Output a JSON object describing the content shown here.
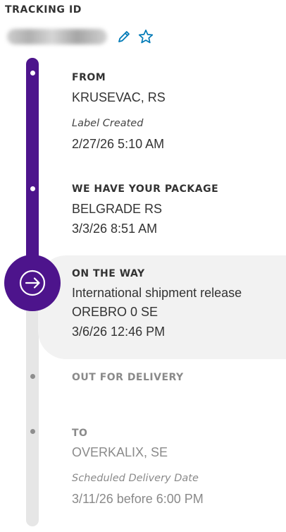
{
  "header": {
    "tracking_label": "TRACKING ID",
    "tracking_number_hidden": true,
    "edit_icon": "pencil-icon",
    "favorite_icon": "star-icon"
  },
  "colors": {
    "accent_purple": "#4d148c",
    "rail_gray": "#e6e6e6",
    "highlight_bg": "#f2f2f2",
    "link_blue": "#007ab7",
    "muted_text": "#8a8a8a"
  },
  "steps": [
    {
      "title": "FROM",
      "location": "KRUSEVAC, RS",
      "event_label": "Label Created",
      "datetime": "2/27/26 5:10 AM",
      "state": "completed"
    },
    {
      "title": "WE HAVE YOUR PACKAGE",
      "location": "BELGRADE RS",
      "datetime": "3/3/26 8:51 AM",
      "state": "completed"
    },
    {
      "title": "ON THE WAY",
      "status": "International shipment release",
      "location": "OREBRO 0 SE",
      "datetime": "3/6/26 12:46 PM",
      "state": "current",
      "icon": "arrow-right-icon"
    },
    {
      "title": "OUT FOR DELIVERY",
      "state": "pending"
    },
    {
      "title": "TO",
      "location": "OVERKALIX, SE",
      "event_label": "Scheduled Delivery Date",
      "datetime": "3/11/26 before 6:00 PM",
      "state": "pending"
    }
  ]
}
